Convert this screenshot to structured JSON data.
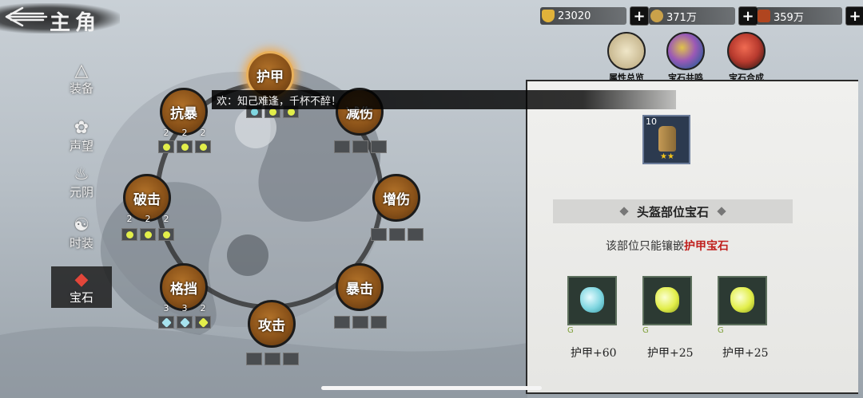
{
  "header": {
    "title": "主角",
    "resources": [
      {
        "name": "gold-ingot",
        "value": "23020",
        "color": "#e1b23a"
      },
      {
        "name": "coin",
        "value": "371万",
        "color": "#c9a14a"
      },
      {
        "name": "scroll",
        "value": "359万",
        "color": "#b0451f"
      }
    ],
    "shortcuts": [
      {
        "label": "属性总览",
        "icon": "scroll-icon",
        "color": "#d8c9a0"
      },
      {
        "label": "宝石共鸣",
        "icon": "gem-cluster-icon",
        "color": "#9b59b6"
      },
      {
        "label": "宝石合成",
        "icon": "gem-forge-icon",
        "color": "#b83a2e"
      }
    ]
  },
  "nav": [
    {
      "label": "装备",
      "icon": "robe-icon"
    },
    {
      "label": "声望",
      "icon": "lotus-icon"
    },
    {
      "label": "元阴",
      "icon": "flame-icon"
    },
    {
      "label": "时装",
      "icon": "costume-icon"
    },
    {
      "label": "宝石",
      "icon": "gem-icon",
      "active": true
    }
  ],
  "wheel": {
    "nodes": [
      {
        "label": "护甲",
        "selected": true
      },
      {
        "label": "减伤"
      },
      {
        "label": "增伤"
      },
      {
        "label": "暴击"
      },
      {
        "label": "攻击"
      },
      {
        "label": "格挡"
      },
      {
        "label": "破击"
      },
      {
        "label": "抗暴"
      }
    ],
    "counts": {
      "kangbao": [
        "2",
        "2",
        "2"
      ],
      "poji": [
        "2",
        "2",
        "2"
      ],
      "gedang": [
        "3",
        "3",
        "2"
      ]
    }
  },
  "banner": {
    "text": "欢：知己难逢，千杯不醉！"
  },
  "panel": {
    "item_level": "10",
    "item_stars": "★★",
    "section_title": "头盔部位宝石",
    "desc_prefix": "该部位只能镶嵌",
    "desc_highlight": "护甲宝石",
    "gems": [
      {
        "color": "#7fd6e0",
        "grade": "G",
        "stat": "护甲+60"
      },
      {
        "color": "#e2ee4a",
        "grade": "G",
        "stat": "护甲+25"
      },
      {
        "color": "#e2ee4a",
        "grade": "G",
        "stat": "护甲+25"
      }
    ]
  }
}
